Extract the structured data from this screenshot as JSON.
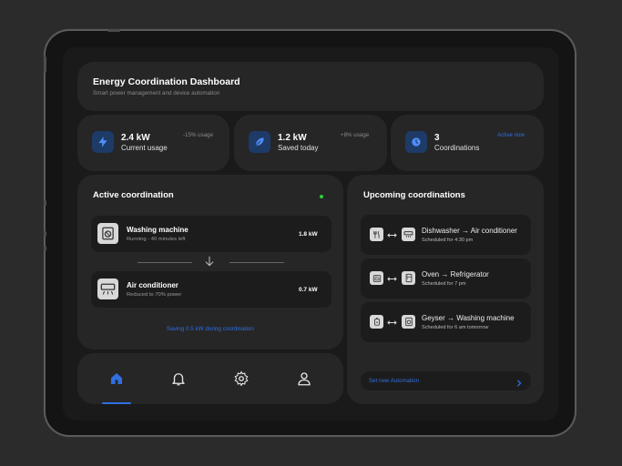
{
  "header": {
    "title": "Energy Coordination Dashboard",
    "subtitle": "Smart power management and device automation"
  },
  "stats": [
    {
      "value": "2.4 kW",
      "label": "Current usage",
      "meta": "-15% usage",
      "icon": "lightning-icon"
    },
    {
      "value": "1.2 kW",
      "label": "Saved today",
      "meta": "+8% usage",
      "icon": "leaf-icon"
    },
    {
      "value": "3",
      "label": "Coordinations",
      "meta": "Active now",
      "icon": "clock-icon"
    }
  ],
  "active": {
    "title": "Active coordination",
    "status_color": "#2ecc40",
    "devices": [
      {
        "name": "Washing machine",
        "detail": "Running - 40 minutes left",
        "power": "1.8 kW",
        "icon": "washing-machine-icon"
      },
      {
        "name": "Air conditioner",
        "detail": "Reduced to 70% power",
        "power": "0.7 kW",
        "icon": "air-conditioner-icon"
      }
    ],
    "saving_text": "Saving 0.5 kW during coordination"
  },
  "upcoming": {
    "title": "Upcoming coordinations",
    "items": [
      {
        "title": "Dishwasher → Air conditioner",
        "schedule": "Scheduled for 4:30 pm",
        "icons": [
          "dishwasher-icon",
          "air-conditioner-icon"
        ]
      },
      {
        "title": "Oven → Refrigerator",
        "schedule": "Scheduled for 7 pm",
        "icons": [
          "oven-icon",
          "refrigerator-icon"
        ]
      },
      {
        "title": "Geyser → Washing machine",
        "schedule": "Scheduled for 6 am tomorrow",
        "icons": [
          "geyser-icon",
          "washing-machine-icon"
        ]
      }
    ],
    "action_label": "Set new Automation"
  },
  "nav": {
    "items": [
      "home-icon",
      "bell-icon",
      "gear-icon",
      "user-icon"
    ],
    "active_index": 0
  },
  "colors": {
    "accent": "#2f6fe0",
    "card": "#262626",
    "background": "#1a1a1a"
  }
}
